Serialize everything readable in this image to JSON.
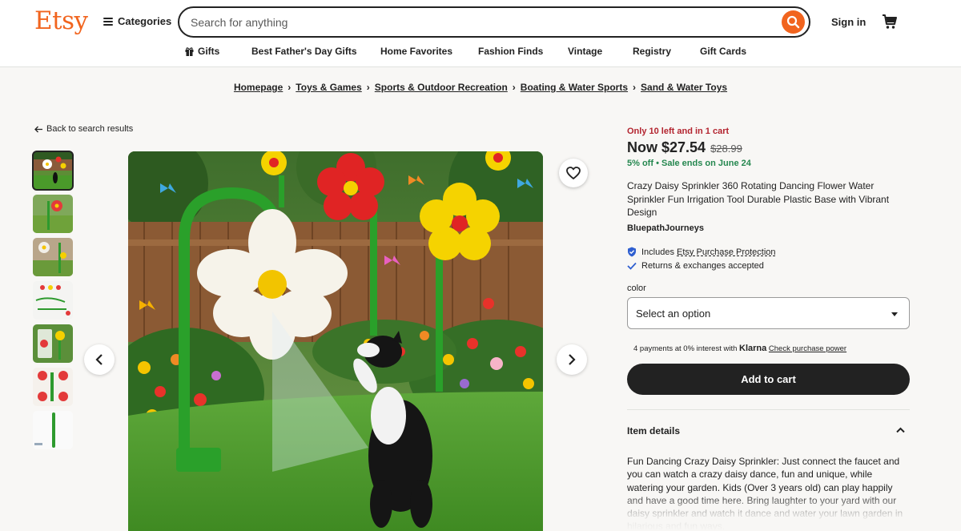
{
  "header": {
    "logo": "Etsy",
    "categories_label": "Categories",
    "search_placeholder": "Search for anything",
    "signin_label": "Sign in"
  },
  "nav": {
    "items": [
      "Gifts",
      "Best Father's Day Gifts",
      "Home Favorites",
      "Fashion Finds",
      "Vintage",
      "Registry",
      "Gift Cards"
    ]
  },
  "breadcrumb": [
    "Homepage",
    "Toys & Games",
    "Sports & Outdoor Recreation",
    "Boating & Water Sports",
    "Sand & Water Toys"
  ],
  "back_link": "Back to search results",
  "product": {
    "stock_notice": "Only 10 left and in 1 cart",
    "price_now": "Now $27.54",
    "price_original": "$28.99",
    "discount": "5% off",
    "sale_ends": "Sale ends on June 24",
    "title": "Crazy Daisy Sprinkler 360 Rotating Dancing Flower Water Sprinkler Fun Irrigation Tool Durable Plastic Base with Vibrant Design",
    "shop_name": "BluepathJourneys",
    "protection_prefix": "Includes ",
    "protection_link": "Etsy Purchase Protection",
    "returns": "Returns & exchanges accepted",
    "option_label": "color",
    "option_placeholder": "Select an option",
    "klarna_text": "4 payments at 0% interest with ",
    "klarna_brand": "Klarna",
    "klarna_link": "Check purchase power",
    "add_to_cart": "Add to cart",
    "details_heading": "Item details",
    "description": "Fun Dancing Crazy Daisy Sprinkler: Just connect the faucet and you can watch a crazy daisy dance, fun and unique, while watering your garden. Kids (Over 3 years old) can play happily and have a good time here. Bring laughter to your yard with our daisy sprinkler and watch it dance and water your lawn garden in hilarious and fun ways."
  },
  "colors": {
    "brand": "#f1641e",
    "stock": "#b3242f",
    "sale": "#25874f",
    "cart_button": "#222222"
  },
  "icons": [
    "hamburger-icon",
    "search-icon",
    "cart-icon",
    "gift-icon",
    "arrow-left-icon",
    "heart-icon",
    "chevron-left-icon",
    "chevron-right-icon",
    "shield-check-icon",
    "checkmark-icon",
    "caret-down-icon",
    "chevron-up-icon"
  ]
}
